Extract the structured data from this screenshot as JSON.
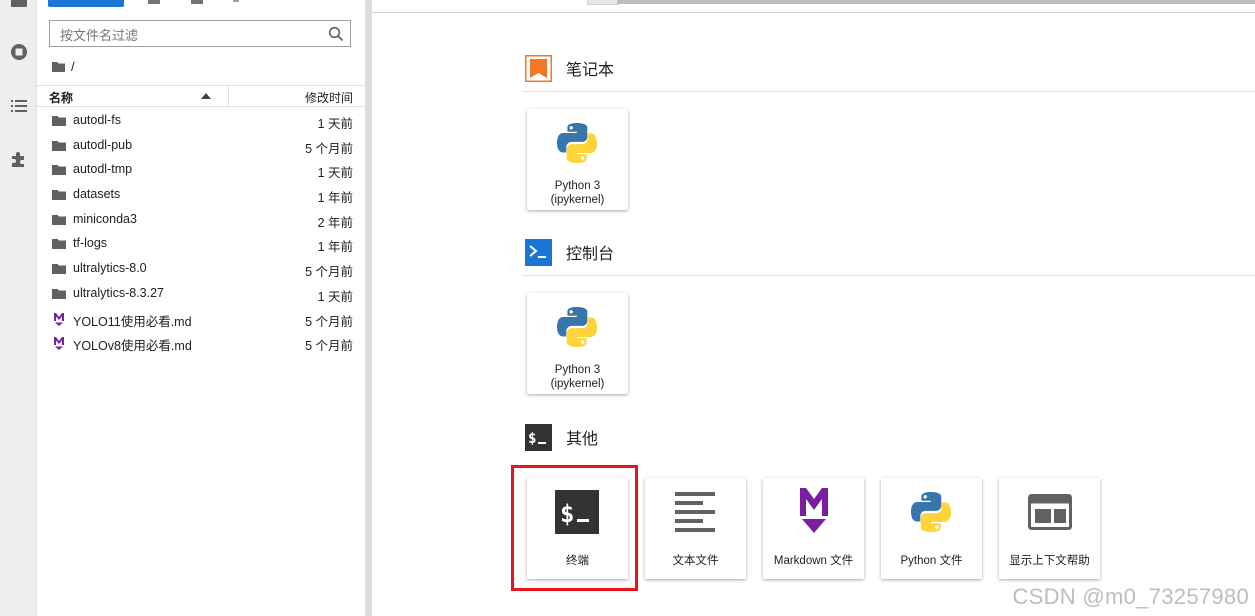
{
  "file_browser": {
    "search_placeholder": "按文件名过滤",
    "breadcrumb": "/",
    "columns": {
      "name": "名称",
      "modified": "修改时间"
    },
    "files": [
      {
        "name": "autodl-fs",
        "modified": "1 天前",
        "type": "folder"
      },
      {
        "name": "autodl-pub",
        "modified": "5 个月前",
        "type": "folder"
      },
      {
        "name": "autodl-tmp",
        "modified": "1 天前",
        "type": "folder"
      },
      {
        "name": "datasets",
        "modified": "1 年前",
        "type": "folder"
      },
      {
        "name": "miniconda3",
        "modified": "2 年前",
        "type": "folder"
      },
      {
        "name": "tf-logs",
        "modified": "1 年前",
        "type": "folder"
      },
      {
        "name": "ultralytics-8.0",
        "modified": "5 个月前",
        "type": "folder"
      },
      {
        "name": "ultralytics-8.3.27",
        "modified": "1 天前",
        "type": "folder"
      },
      {
        "name": "YOLO11使用必看.md",
        "modified": "5 个月前",
        "type": "markdown"
      },
      {
        "name": "YOLOv8使用必看.md",
        "modified": "5 个月前",
        "type": "markdown"
      }
    ]
  },
  "launcher": {
    "notebook": {
      "title": "笔记本",
      "cards": [
        {
          "line1": "Python 3",
          "line2": "(ipykernel)",
          "icon": "python-logo-icon"
        }
      ]
    },
    "console": {
      "title": "控制台",
      "cards": [
        {
          "line1": "Python 3",
          "line2": "(ipykernel)",
          "icon": "python-logo-icon"
        }
      ]
    },
    "other": {
      "title": "其他",
      "cards": [
        {
          "label": "终端",
          "icon": "terminal-icon",
          "highlighted": true
        },
        {
          "label": "文本文件",
          "icon": "text-file-icon"
        },
        {
          "label": "Markdown 文件",
          "icon": "markdown-icon"
        },
        {
          "label": "Python 文件",
          "icon": "python-logo-icon"
        },
        {
          "label": "显示上下文帮助",
          "icon": "context-help-icon"
        }
      ]
    }
  },
  "watermark": "CSDN @m0_73257980",
  "colors": {
    "notebook_accent": "#f37726",
    "console_accent": "#1976d2",
    "terminal_bg": "#333333",
    "markdown_purple": "#7b1fa2",
    "highlight_red": "#e8141b",
    "python_blue": "#3776ab",
    "python_yellow": "#ffd43b"
  }
}
